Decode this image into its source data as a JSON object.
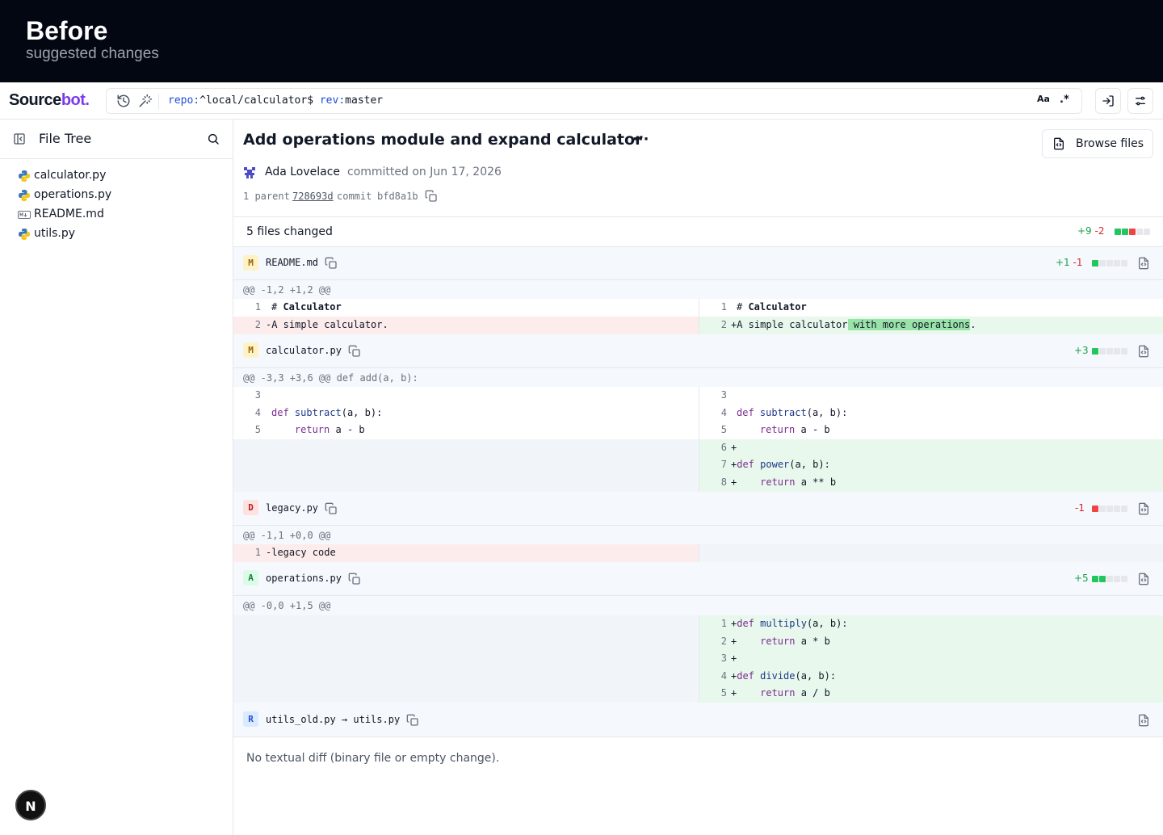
{
  "banner": {
    "title": "Before",
    "subtitle": "suggested changes"
  },
  "topbar": {
    "logo_main": "Source",
    "logo_accent": "bot.",
    "query_repo_key": "repo:",
    "query_repo_val": "^local/calculator$ ",
    "query_rev_key": "rev:",
    "query_rev_val": "master",
    "case_toggle": "Aa",
    "regex_toggle": ".*"
  },
  "sidebar": {
    "title": "File Tree",
    "files": [
      {
        "name": "calculator.py",
        "icon": "python-icon"
      },
      {
        "name": "operations.py",
        "icon": "python-icon"
      },
      {
        "name": "README.md",
        "icon": "markdown-icon"
      },
      {
        "name": "utils.py",
        "icon": "python-icon"
      }
    ],
    "next_badge": "N"
  },
  "commit": {
    "title": "Add operations module and expand calculator",
    "more": "···",
    "browse_label": "Browse files",
    "author": "Ada Lovelace",
    "date_text": "committed on Jun 17, 2026",
    "parent_label": "1 parent",
    "parent_hash": "728693d",
    "commit_label": "commit",
    "commit_hash": "bfd8a1b"
  },
  "summary": {
    "label": "5 files changed",
    "additions": "+9",
    "deletions": "-2"
  },
  "files": [
    {
      "status": "M",
      "name": "README.md",
      "additions": "+1",
      "deletions": "-1",
      "hunk": "@@ -1,2 +1,2 @@"
    },
    {
      "status": "M",
      "name": "calculator.py",
      "additions": "+3",
      "deletions": "",
      "hunk": "@@ -3,3 +3,6 @@ def add(a, b):"
    },
    {
      "status": "D",
      "name": "legacy.py",
      "additions": "",
      "deletions": "-1",
      "hunk": "@@ -1,1 +0,0 @@"
    },
    {
      "status": "A",
      "name": "operations.py",
      "additions": "+5",
      "deletions": "",
      "hunk": "@@ -0,0 +1,5 @@"
    },
    {
      "status": "R",
      "name": "utils_old.py → utils.py",
      "additions": "",
      "deletions": "",
      "hunk": ""
    }
  ],
  "diff": {
    "readme": {
      "l1_no": "1",
      "l1_text": "# ",
      "l1_bold": "Calculator",
      "l2_no": "2",
      "l2_text": "-A simple calculator.",
      "r1_no": "1",
      "r1_text": "# ",
      "r1_bold": "Calculator",
      "r2_no": "2",
      "r2_pre": "+A simple calculator",
      "r2_hl": " with more operations",
      "r2_post": "."
    },
    "calc": {
      "l3": "3",
      "l4": "4",
      "l5": "5",
      "r3": "3",
      "r4": "4",
      "r5": "5",
      "r6": "6",
      "r7": "7",
      "r8": "8"
    },
    "legacy": {
      "no": "1",
      "text": "-legacy code"
    },
    "ops": {
      "r1": "1",
      "r2": "2",
      "r3": "3",
      "r4": "4",
      "r5": "5"
    }
  },
  "no_diff_text": "No textual diff (binary file or empty change)."
}
